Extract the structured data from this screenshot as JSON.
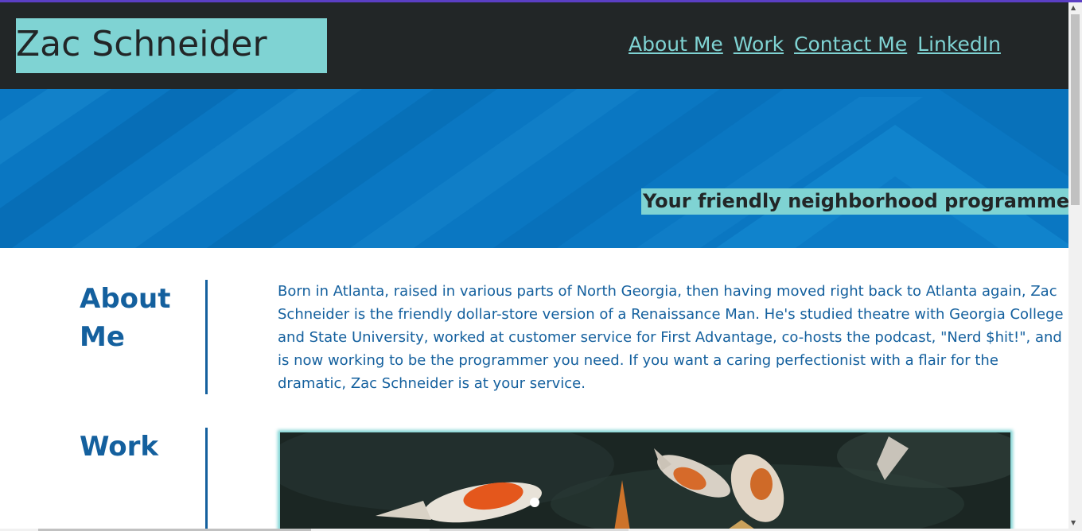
{
  "header": {
    "logo_text": "Zac Schneider",
    "nav": [
      "About Me",
      "Work",
      "Contact Me",
      "LinkedIn"
    ]
  },
  "hero": {
    "tagline": "Your friendly neighborhood programmer!"
  },
  "about": {
    "title_line1": "About",
    "title_line2": "Me",
    "text": "Born in Atlanta, raised in various parts of North Georgia, then having moved right back to Atlanta again, Zac Schneider is the friendly dollar-store version of a Renaissance Man. He's studied theatre with Georgia College and State University, worked at customer service for First Advantage, co-hosts the podcast, \"Nerd $hit!\", and is now working to be the programmer you need. If you want a caring perfectionist with a flair for the dramatic, Zac Schneider is at your service."
  },
  "work": {
    "title": "Work"
  },
  "colors": {
    "accent": "#7fd3d3",
    "header_bg": "#222627",
    "heading_blue": "#14609e",
    "hero_blue": "#0a77c2"
  },
  "icons": [
    "koi-fish-image"
  ]
}
